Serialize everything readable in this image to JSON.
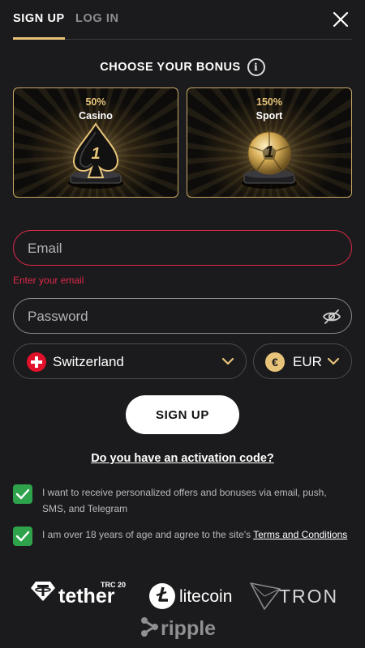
{
  "tabs": {
    "signup": "SIGN UP",
    "login": "LOG IN"
  },
  "bonus": {
    "heading": "CHOOSE YOUR BONUS",
    "info_glyph": "i",
    "cards": [
      {
        "percent": "50%",
        "name": "Casino",
        "badge": "1",
        "icon": "spade-trophy-icon"
      },
      {
        "percent": "150%",
        "name": "Sport",
        "badge": "1",
        "icon": "ball-trophy-icon"
      }
    ]
  },
  "form": {
    "email_placeholder": "Email",
    "email_error": "Enter your email",
    "password_placeholder": "Password",
    "country": "Switzerland",
    "currency": "EUR",
    "currency_symbol": "€",
    "submit": "SIGN UP",
    "activation": "Do you have an activation code?"
  },
  "consents": {
    "offers": "I want to receive personalized offers and bonuses via email, push, SMS, and Telegram",
    "age_prefix": "I am over 18 years of age and agree to the site's ",
    "terms_link": "Terms and Conditions"
  },
  "payment_logos": {
    "tether": "tether",
    "tether_badge": "TRC 20",
    "litecoin": "litecoin",
    "tron": "TRON",
    "ripple": "ripple"
  },
  "colors": {
    "background": "#1b1b1d",
    "accent_gold": "#e8c47a",
    "error": "#e0294a",
    "check_green": "#2fa34b"
  }
}
